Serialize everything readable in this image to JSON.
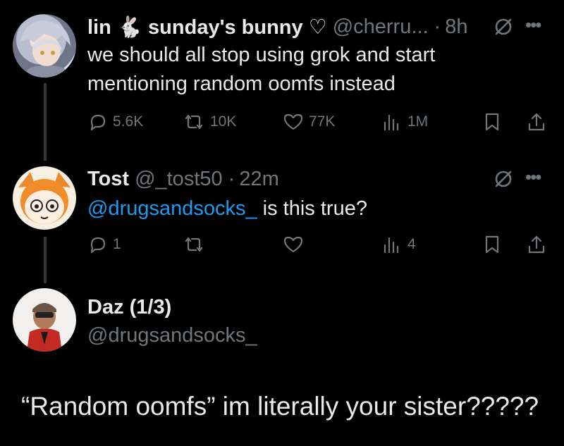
{
  "tweets": [
    {
      "display_name": "lin 🐇 sunday's bunny ♡",
      "handle": "@cherru...",
      "dot": "·",
      "time": "8h",
      "text": "we should all stop using grok and start mentioning random oomfs instead",
      "actions": {
        "replies": "5.6K",
        "reposts": "10K",
        "likes": "77K",
        "views": "1M"
      }
    },
    {
      "display_name": "Tost",
      "handle": "@_tost50",
      "dot": "·",
      "time": "22m",
      "mention": "@drugsandsocks_",
      "text_after": " is this true?",
      "actions": {
        "replies": "1",
        "reposts": "",
        "likes": "",
        "views": "4"
      }
    },
    {
      "display_name": "Daz (1/3)",
      "handle": "@drugsandsocks_",
      "text": "“Random oomfs” im literally your sister?????"
    }
  ],
  "icons": {
    "reply": "reply-icon",
    "repost": "repost-icon",
    "like": "heart-icon",
    "views": "views-icon",
    "bookmark": "bookmark-icon",
    "share": "share-icon",
    "more": "more-icon",
    "grok": "grok-icon"
  },
  "colors": {
    "background": "#000000",
    "text": "#e7e9ea",
    "muted": "#71767b",
    "link": "#1d9bf0",
    "thread_line": "#333639"
  }
}
